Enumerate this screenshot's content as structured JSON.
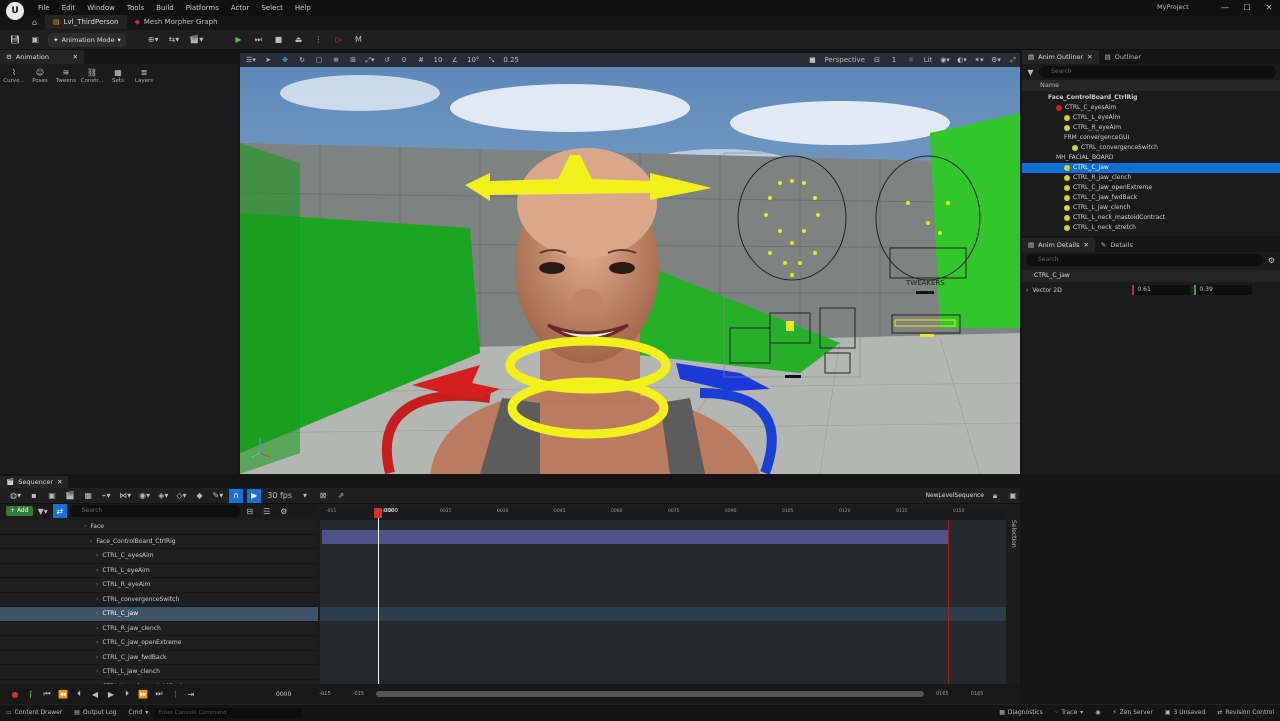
{
  "menubar": {
    "items": [
      "File",
      "Edit",
      "Window",
      "Tools",
      "Build",
      "Platforms",
      "Actor",
      "Select",
      "Help"
    ],
    "project": "MyProject"
  },
  "tabs": [
    {
      "label": "Lvl_ThirdPerson"
    },
    {
      "label": "Mesh Morpher Graph"
    }
  ],
  "toolbar": {
    "mode": "Animation Mode"
  },
  "animation_panel": {
    "tab": "Animation",
    "tools": [
      "Curve...",
      "Poses",
      "Tweens",
      "Constr...",
      "Sets",
      "Layers"
    ]
  },
  "viewport": {
    "perspective": "Perspective",
    "view_count": "1",
    "lit": "Lit",
    "rot_snap": "0",
    "grid_snap": "10",
    "angle_snap": "10°",
    "scale_snap": "0.25",
    "board_label": "TWEAKERS"
  },
  "outliner": {
    "tabs": [
      "Anim Outliner",
      "Outliner"
    ],
    "search_placeholder": "Search",
    "column": "Name",
    "items": [
      {
        "label": "Face_ControlBoard_CtrlRig",
        "indent": 1,
        "bold": true
      },
      {
        "label": "CTRL_C_eyesAim",
        "indent": 2,
        "dot": "#d02020"
      },
      {
        "label": "CTRL_L_eyeAim",
        "indent": 3,
        "dot": "#d6d62a"
      },
      {
        "label": "CTRL_R_eyeAim",
        "indent": 3,
        "dot": "#d6d62a"
      },
      {
        "label": "FRM_convergenceGUI",
        "indent": 3
      },
      {
        "label": "CTRL_convergenceSwitch",
        "indent": 4,
        "dot": "#d6d62a"
      },
      {
        "label": "MH_FACIAL_BOARD",
        "indent": 2
      },
      {
        "label": "CTRL_C_jaw",
        "indent": 3,
        "dot": "#d6d62a",
        "sel": true
      },
      {
        "label": "CTRL_R_jaw_clench",
        "indent": 3,
        "dot": "#d6d62a"
      },
      {
        "label": "CTRL_C_jaw_openExtreme",
        "indent": 3,
        "dot": "#d6d62a"
      },
      {
        "label": "CTRL_C_jaw_fwdBack",
        "indent": 3,
        "dot": "#d6d62a"
      },
      {
        "label": "CTRL_L_jaw_clench",
        "indent": 3,
        "dot": "#d6d62a"
      },
      {
        "label": "CTRL_L_neck_mastoidContract",
        "indent": 3,
        "dot": "#d6d62a"
      },
      {
        "label": "CTRL_L_neck_stretch",
        "indent": 3,
        "dot": "#d6d62a"
      }
    ]
  },
  "details": {
    "tabs": [
      "Anim Details",
      "Details"
    ],
    "search_placeholder": "Search",
    "control": "CTRL_C_jaw",
    "property": "Vector 2D",
    "x": "0.61",
    "y": "0.39"
  },
  "sequencer": {
    "tab": "Sequencer",
    "fps": "30 fps",
    "sequence": "NewLevelSequence",
    "add": "Add",
    "search_placeholder": "Search",
    "playhead": "0000",
    "ticks": [
      "-015",
      "0000",
      "0015",
      "0030",
      "0045",
      "0060",
      "0075",
      "0090",
      "0105",
      "0120",
      "0135",
      "0150"
    ],
    "bottom_left": "-015",
    "bottom_left2": "-015",
    "bottom_right": "0165",
    "bottom_right2": "0165",
    "frame_field": "0000",
    "selection_label": "Selection",
    "tracks": [
      {
        "label": "Face",
        "indent": 0
      },
      {
        "label": "Face_ControlBoard_CtrlRig",
        "indent": 1
      },
      {
        "label": "CTRL_C_eyesAim",
        "indent": 2
      },
      {
        "label": "CTRL_L_eyeAim",
        "indent": 2
      },
      {
        "label": "CTRL_R_eyeAim",
        "indent": 2
      },
      {
        "label": "CTRL_convergenceSwitch",
        "indent": 2
      },
      {
        "label": "CTRL_C_jaw",
        "indent": 2,
        "sel": true
      },
      {
        "label": "CTRL_R_jaw_clench",
        "indent": 2
      },
      {
        "label": "CTRL_C_jaw_openExtreme",
        "indent": 2
      },
      {
        "label": "CTRL_C_jaw_fwdBack",
        "indent": 2
      },
      {
        "label": "CTRL_L_jaw_clench",
        "indent": 2
      },
      {
        "label": "CTRL_L_neck_mastoidContrac",
        "indent": 2
      }
    ]
  },
  "statusbar": {
    "content_drawer": "Content Drawer",
    "output_log": "Output Log",
    "cmd": "Cmd",
    "console_placeholder": "Enter Console Command",
    "diagnostics": "Diagnostics",
    "trace": "Trace",
    "zen": "Zen Server",
    "unsaved": "3 Unsaved",
    "revision": "Revision Control"
  }
}
